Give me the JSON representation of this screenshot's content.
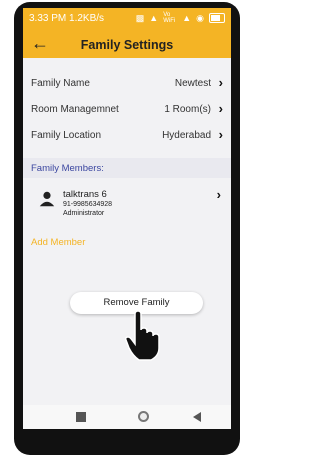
{
  "status_bar": {
    "time": "3.33 PM",
    "speed": "1.2KB/s",
    "icons": [
      "message-icon",
      "signal-icon",
      "wifi-calling-icon",
      "signal-icon",
      "wifi-icon",
      "battery-icon"
    ],
    "wifi_label": "Vo WiFi"
  },
  "app_bar": {
    "title": "Family Settings",
    "back_icon": "arrow-left-icon"
  },
  "settings": {
    "family_name_label": "Family Name",
    "family_name_value": "Newtest",
    "room_label": "Room Managemnet",
    "room_value": "1 Room(s)",
    "location_label": "Family Location",
    "location_value": "Hyderabad"
  },
  "members_section": {
    "header": "Family Members:",
    "members": [
      {
        "name": "talktrans 6",
        "phone": "91-9985634928",
        "role": "Administrator"
      }
    ],
    "add_member_label": "Add Member"
  },
  "actions": {
    "remove_family_label": "Remove Family"
  },
  "colors": {
    "accent": "#f4b425",
    "section_text": "#3b46a0",
    "background": "#f2f2f4"
  }
}
